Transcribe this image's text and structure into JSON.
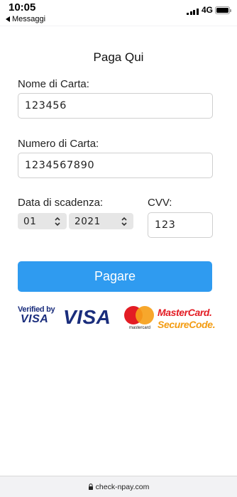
{
  "status_bar": {
    "time": "10:05",
    "back_label": "Messaggi",
    "network": "4G"
  },
  "form": {
    "title": "Paga Qui",
    "card_name_label": "Nome di Carta:",
    "card_name_value": "123456",
    "card_number_label": "Numero di Carta:",
    "card_number_value": "1234567890",
    "expiry_label": "Data di scadenza:",
    "expiry_month": "01",
    "expiry_year": "2021",
    "cvv_label": "CVV:",
    "cvv_value": "123",
    "pay_button": "Pagare"
  },
  "logos": {
    "verified_by": "Verified by",
    "visa_small": "VISA",
    "visa": "VISA",
    "mastercard_caption": "mastercard",
    "mastercard": "MasterCard.",
    "securecode": "SecureCode."
  },
  "browser": {
    "url": "check-npay.com"
  },
  "colors": {
    "pay_button": "#2f9bf0",
    "visa_blue": "#1a2d7c",
    "mastercard_red": "#e31c24",
    "mastercard_yellow": "#f6a01a"
  }
}
